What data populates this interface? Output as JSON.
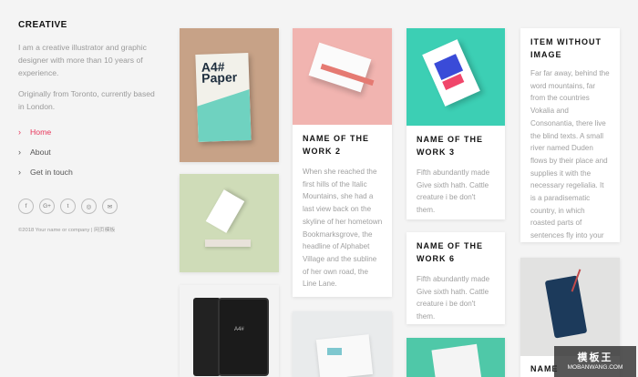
{
  "sidebar": {
    "brand": "CREATIVE",
    "intro": "I am a creative illustrator and graphic designer with more than 10 years of experience.",
    "origin": "Originally from Toronto, currently based in London.",
    "nav": [
      {
        "label": "Home",
        "active": true
      },
      {
        "label": "About",
        "active": false
      },
      {
        "label": "Get in touch",
        "active": false
      }
    ],
    "socials": [
      "f",
      "G+",
      "t",
      "◎",
      "✉"
    ],
    "copyright": "©2018 Your name or company | 网页模板"
  },
  "cards": {
    "work2": {
      "title": "NAME OF THE WORK 2",
      "text": "When she reached the first hills of the Italic Mountains, she had a last view back on the skyline of her hometown Bookmarksgrove, the headline of Alphabet Village and the subline of her own road, the Line Lane."
    },
    "work3": {
      "title": "NAME OF THE WORK 3",
      "text": "Fifth abundantly made Give sixth hath. Cattle creature i be don't them."
    },
    "work6": {
      "title": "NAME OF THE WORK 6",
      "text": "Fifth abundantly made Give sixth hath. Cattle creature i be don't them."
    },
    "noimage": {
      "title": "ITEM WITHOUT IMAGE",
      "text": "Far far away, behind the word mountains, far from the countries Vokalia and Consonantia, there live the blind texts. A small river named Duden flows by their place and supplies it with the necessary regelialia. It is a paradisematic country, in which roasted parts of sentences fly into your mouth."
    },
    "bottom_partial": {
      "title": "NAME"
    },
    "poster": {
      "text": "A4#\nPaper"
    },
    "phone": {
      "text": "A4#"
    }
  },
  "watermark": {
    "big": "模板王",
    "small": "MOBANWANG.COM"
  }
}
